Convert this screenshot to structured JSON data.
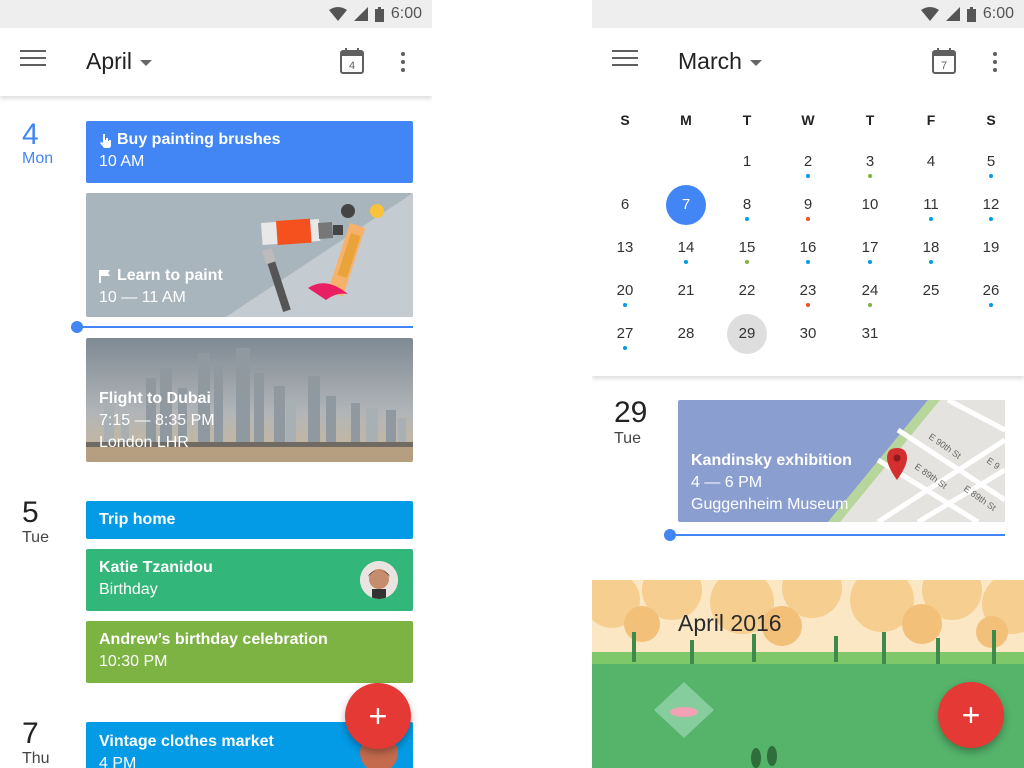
{
  "status": {
    "time": "6:00"
  },
  "left": {
    "appbar": {
      "month": "April",
      "calendar_icon_day": "4"
    },
    "days": [
      {
        "num": "4",
        "name": "Mon"
      },
      {
        "num": "5",
        "name": "Tue"
      },
      {
        "num": "7",
        "name": "Thu"
      }
    ],
    "events": {
      "brushes": {
        "title": "Buy painting brushes",
        "time": "10 AM",
        "color": "#4285f4"
      },
      "paint": {
        "title": "Learn to paint",
        "time": "10 — 11 AM"
      },
      "dubai": {
        "title": "Flight to Dubai",
        "time": "7:15 — 8:35 PM",
        "place": "London LHR"
      },
      "trip": {
        "title": "Trip home",
        "color": "#039be5"
      },
      "katie": {
        "title": "Katie Tzanidou",
        "sub": "Birthday",
        "color": "#33b679"
      },
      "andrew": {
        "title": "Andrew’s birthday celebration",
        "time": "10:30 PM",
        "color": "#7cb342"
      },
      "market": {
        "title": "Vintage clothes market",
        "time": "4 PM",
        "color": "#039be5"
      }
    },
    "fab_label": "+"
  },
  "right": {
    "appbar": {
      "month": "March",
      "calendar_icon_day": "7"
    },
    "weekdays": [
      "S",
      "M",
      "T",
      "W",
      "T",
      "F",
      "S"
    ],
    "weeks": [
      [
        "",
        "",
        "1",
        "2",
        "3",
        "4",
        "5"
      ],
      [
        "6",
        "7",
        "8",
        "9",
        "10",
        "11",
        "12"
      ],
      [
        "13",
        "14",
        "15",
        "16",
        "17",
        "18",
        "19"
      ],
      [
        "20",
        "21",
        "22",
        "23",
        "24",
        "25",
        "26"
      ],
      [
        "27",
        "28",
        "29",
        "30",
        "31",
        "",
        ""
      ]
    ],
    "selected_day": "7",
    "today_day": "29",
    "event_dots": [
      {
        "day": "2",
        "color": "#039be5"
      },
      {
        "day": "3",
        "color": "#7cb342"
      },
      {
        "day": "5",
        "color": "#039be5"
      },
      {
        "day": "8",
        "color": "#039be5"
      },
      {
        "day": "9",
        "color": "#f4511e"
      },
      {
        "day": "11",
        "color": "#039be5"
      },
      {
        "day": "12",
        "color": "#039be5"
      },
      {
        "day": "14",
        "color": "#039be5"
      },
      {
        "day": "15",
        "color": "#7cb342"
      },
      {
        "day": "16",
        "color": "#039be5"
      },
      {
        "day": "17",
        "color": "#039be5"
      },
      {
        "day": "18",
        "color": "#039be5"
      },
      {
        "day": "20",
        "color": "#039be5"
      },
      {
        "day": "23",
        "color": "#f4511e"
      },
      {
        "day": "24",
        "color": "#7cb342"
      },
      {
        "day": "26",
        "color": "#039be5"
      },
      {
        "day": "27",
        "color": "#039be5"
      }
    ],
    "agenda_day": {
      "num": "29",
      "name": "Tue"
    },
    "kandinsky": {
      "title": "Kandinsky exhibition",
      "time": "4 — 6 PM",
      "place": "Guggenheim Museum"
    },
    "map_streets": [
      "E 90th St",
      "E 89th St",
      "E 89th St",
      "E 9"
    ],
    "banner_title": "April 2016",
    "fab_label": "+"
  }
}
